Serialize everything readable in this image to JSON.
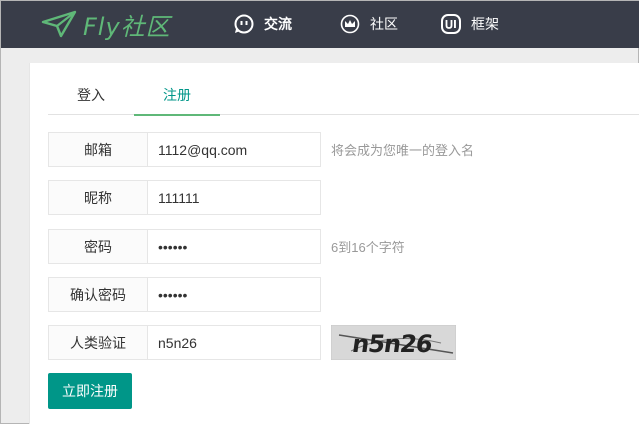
{
  "header": {
    "logo_text": "Fly社区",
    "nav": [
      {
        "label": "交流",
        "icon": "chat-icon",
        "active": true
      },
      {
        "label": "社区",
        "icon": "crown-icon",
        "active": false
      },
      {
        "label": "框架",
        "icon": "ui-icon",
        "active": false
      }
    ]
  },
  "tabs": [
    {
      "label": "登入",
      "active": false
    },
    {
      "label": "注册",
      "active": true
    }
  ],
  "form": {
    "email": {
      "label": "邮箱",
      "value": "1112@qq.com",
      "hint": "将会成为您唯一的登入名"
    },
    "nickname": {
      "label": "昵称",
      "value": "111111"
    },
    "password": {
      "label": "密码",
      "value": "111111",
      "hint": "6到16个字符"
    },
    "confirm_password": {
      "label": "确认密码",
      "value": "111111"
    },
    "captcha": {
      "label": "人类验证",
      "value": "n5n26",
      "image_text": "n5n26"
    },
    "submit_label": "立即注册"
  },
  "colors": {
    "header_bg": "#393d49",
    "brand_green": "#5fb878",
    "button_teal": "#009688"
  }
}
